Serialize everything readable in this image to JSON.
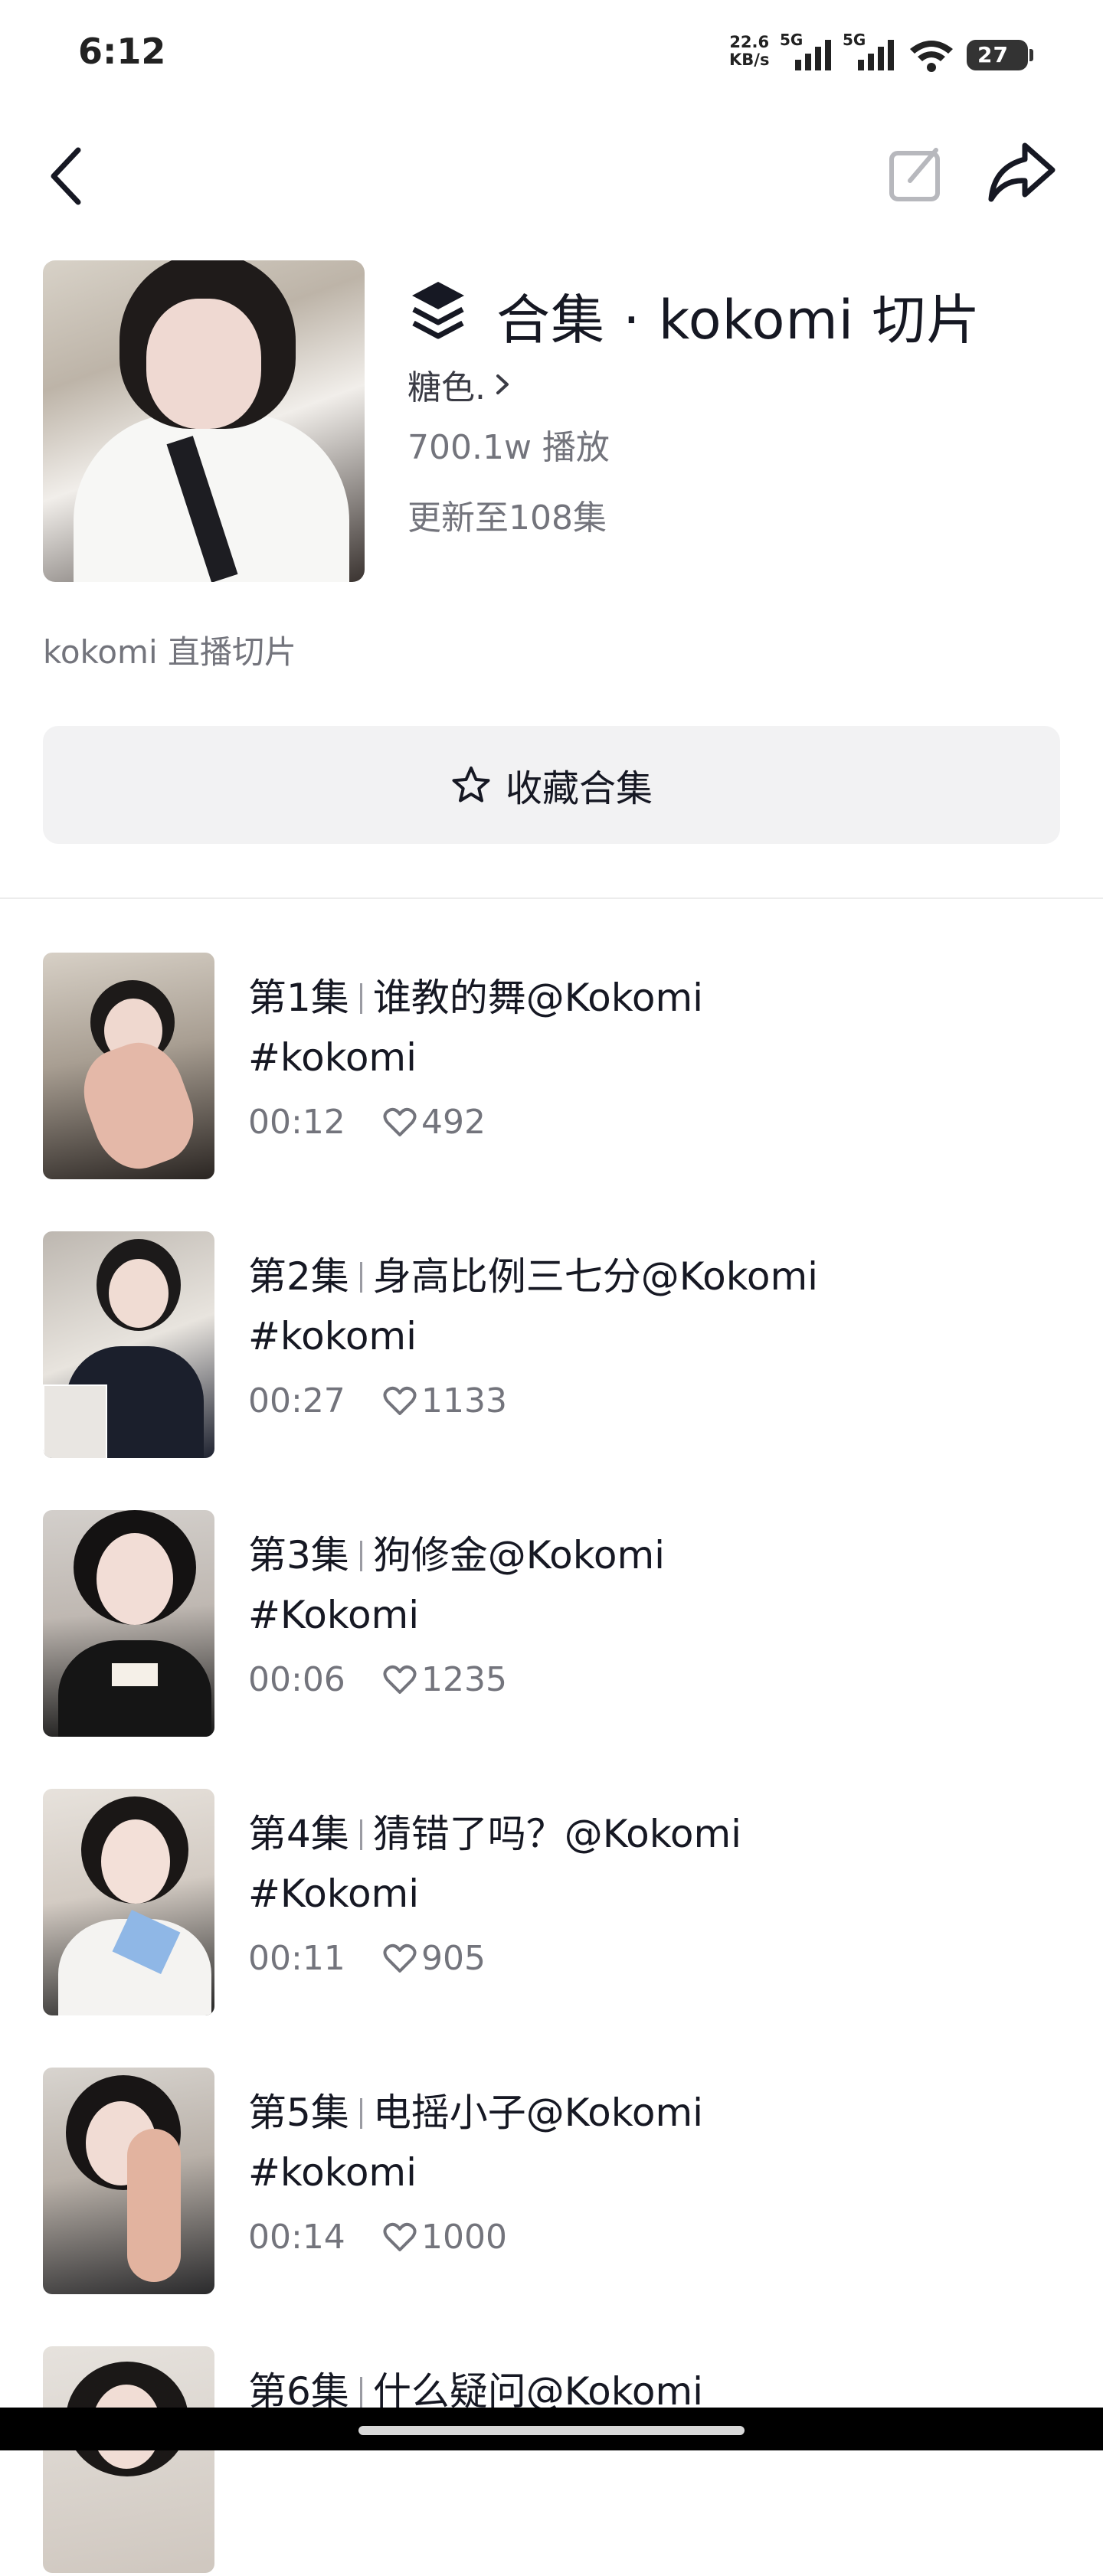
{
  "status_bar": {
    "time": "6:12",
    "net_speed_value": "22.6",
    "net_speed_unit": "KB/s",
    "sim1": "5G",
    "sim2": "5G",
    "battery": "27"
  },
  "collection": {
    "title": "合集 · kokomi 切片",
    "author": "糖色.",
    "plays": "700.1w 播放",
    "update": "更新至108集",
    "description": "kokomi 直播切片",
    "collect_label": "收藏合集"
  },
  "episodes": [
    {
      "ep": "第1集",
      "title": "谁教的舞@Kokomi",
      "tag": "#kokomi",
      "duration": "00:12",
      "likes": "492"
    },
    {
      "ep": "第2集",
      "title": "身高比例三七分@Kokomi",
      "tag": "#kokomi",
      "duration": "00:27",
      "likes": "1133"
    },
    {
      "ep": "第3集",
      "title": "狗修金@Kokomi",
      "tag": "#Kokomi",
      "duration": "00:06",
      "likes": "1235"
    },
    {
      "ep": "第4集",
      "title": "猜错了吗？@Kokomi",
      "tag": "#Kokomi",
      "duration": "00:11",
      "likes": "905"
    },
    {
      "ep": "第5集",
      "title": "电摇小子@Kokomi",
      "tag": "#kokomi",
      "duration": "00:14",
      "likes": "1000"
    },
    {
      "ep": "第6集",
      "title": "什么疑问@Kokomi",
      "tag": "",
      "duration": "",
      "likes": ""
    }
  ],
  "colors": {
    "text_primary": "#161823",
    "text_secondary": "#73747c",
    "button_bg": "#f2f2f3",
    "divider": "#ececec"
  }
}
